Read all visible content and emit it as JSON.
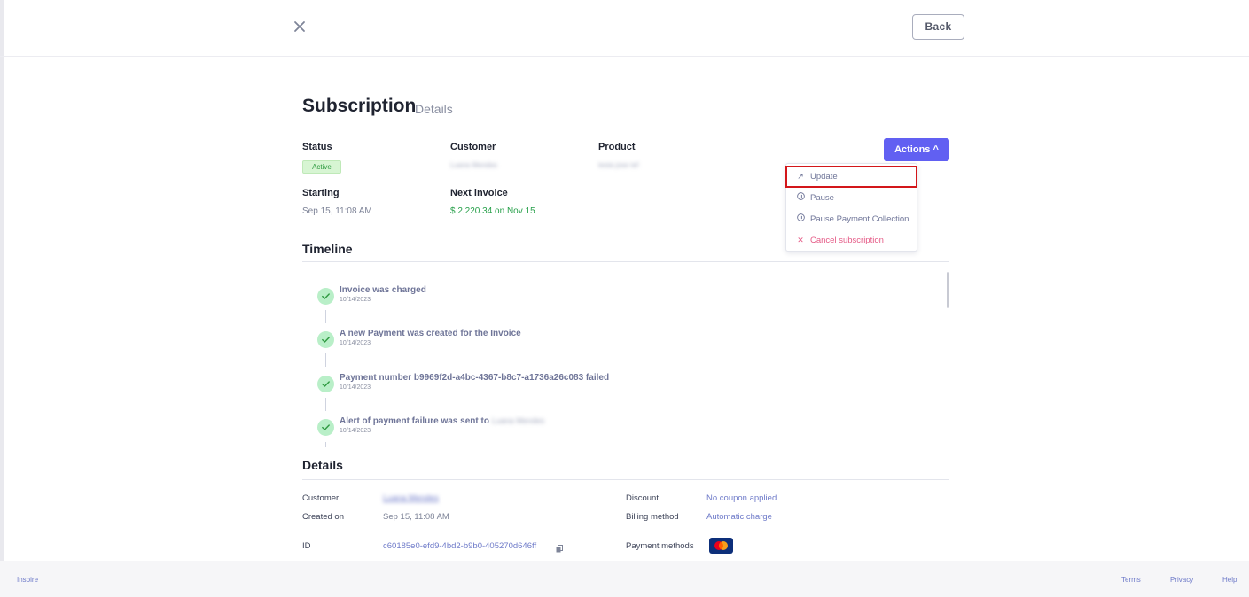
{
  "header": {
    "back_label": "Back"
  },
  "page": {
    "title": "Subscription",
    "subtitle": "Details"
  },
  "summary": {
    "status_label": "Status",
    "status_value": "Active",
    "customer_label": "Customer",
    "customer_value": "Luana Mendes",
    "product_label": "Product",
    "product_value": "testa jose tef",
    "starting_label": "Starting",
    "starting_value": "Sep 15, 11:08 AM",
    "next_invoice_label": "Next invoice",
    "next_invoice_value": "$ 2,220.34 on Nov 15"
  },
  "actions": {
    "button_label": "Actions ^",
    "menu": [
      {
        "label": "Update",
        "icon": "arrow-up-right-icon"
      },
      {
        "label": "Pause",
        "icon": "pause-circle-icon"
      },
      {
        "label": "Pause Payment Collection",
        "icon": "pause-circle-icon"
      },
      {
        "label": "Cancel subscription",
        "icon": "x-icon"
      }
    ]
  },
  "timeline": {
    "title": "Timeline",
    "events": [
      {
        "title": "Invoice was charged",
        "date": "10/14/2023"
      },
      {
        "title": "A new Payment was created for the Invoice",
        "date": "10/14/2023"
      },
      {
        "title": "Payment number b9969f2d-a4bc-4367-b8c7-a1736a26c083 failed",
        "date": "10/14/2023"
      },
      {
        "title": "Alert of payment failure was sent to",
        "title_suffix": "Luana Mendes",
        "date": "10/14/2023"
      }
    ]
  },
  "details": {
    "title": "Details",
    "customer_label": "Customer",
    "customer_value": "Luana Mendes",
    "created_label": "Created on",
    "created_value": "Sep 15, 11:08 AM",
    "id_label": "ID",
    "id_value": "c60185e0-efd9-4bd2-b9b0-405270d646ff",
    "discount_label": "Discount",
    "discount_value": "No coupon applied",
    "billing_label": "Billing method",
    "billing_value": "Automatic charge",
    "payment_methods_label": "Payment methods"
  },
  "footer": {
    "brand": "Inspire",
    "links": [
      "Terms",
      "Privacy",
      "Help"
    ]
  },
  "colors": {
    "accent": "#6160f2",
    "danger": "#e55a86",
    "success": "#27a04a",
    "highlight_border": "#d3161a"
  }
}
